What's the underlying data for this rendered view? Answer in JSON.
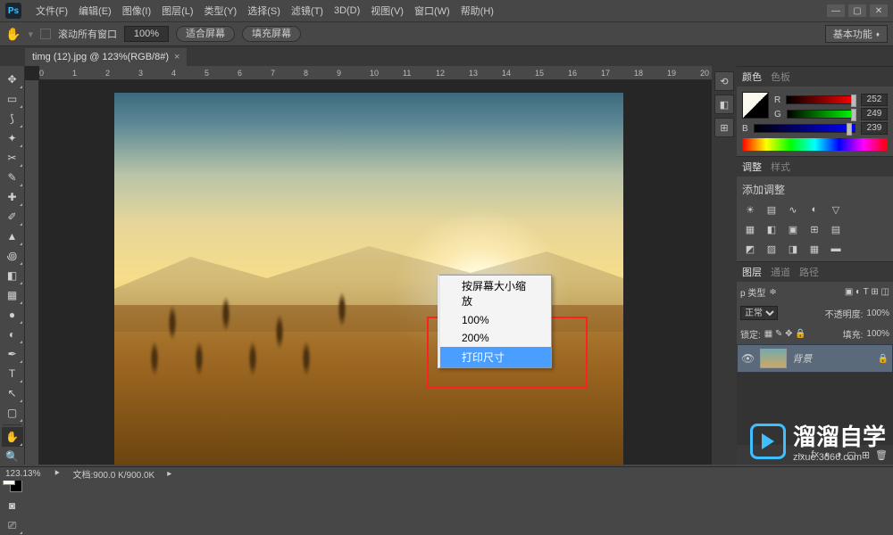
{
  "menu": [
    "文件(F)",
    "编辑(E)",
    "图像(I)",
    "图层(L)",
    "类型(Y)",
    "选择(S)",
    "滤镜(T)",
    "3D(D)",
    "视图(V)",
    "窗口(W)",
    "帮助(H)"
  ],
  "opt": {
    "scrollAll": "滚动所有窗口",
    "zoom": "100%",
    "fitScreen": "适合屏幕",
    "fillScreen": "填充屏幕",
    "workspace": "基本功能"
  },
  "tab": {
    "name": "timg (12).jpg @ 123%(RGB/8#)"
  },
  "ruler": [
    "0",
    "1",
    "2",
    "3",
    "4",
    "5",
    "6",
    "7",
    "8",
    "9",
    "10",
    "11",
    "12",
    "13",
    "14",
    "15",
    "16",
    "17",
    "18",
    "19",
    "20"
  ],
  "context": {
    "items": [
      "按屏幕大小缩放",
      "100%",
      "200%",
      "打印尺寸"
    ],
    "highlighted": 3
  },
  "colorPanel": {
    "tabs": [
      "颜色",
      "色板"
    ],
    "r": {
      "label": "R",
      "val": "252"
    },
    "g": {
      "label": "G",
      "val": "249"
    },
    "b": {
      "label": "B",
      "val": "239"
    }
  },
  "adjPanel": {
    "tabs": [
      "调整",
      "样式"
    ],
    "title": "添加调整"
  },
  "layerPanel": {
    "tabs": [
      "图层",
      "通道",
      "路径"
    ],
    "kind": "p 类型",
    "blend": "正常",
    "opacity": "不透明度:",
    "opacityVal": "100%",
    "lock": "锁定:",
    "fill": "填充:",
    "fillVal": "100%",
    "layerName": "背景"
  },
  "status": {
    "zoom": "123.13%",
    "doc": "文档:900.0 K/900.0K"
  },
  "watermark": {
    "t1": "溜溜自学",
    "t2": "zixue.3d66.com"
  }
}
